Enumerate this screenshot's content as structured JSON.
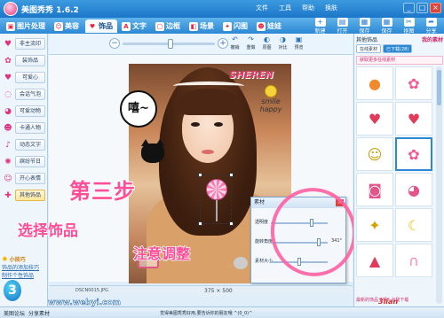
{
  "app": {
    "title": "美图秀秀 1.6.2"
  },
  "menu": [
    "文件",
    "工具",
    "帮助",
    "换肤"
  ],
  "window_buttons": [
    "_",
    "□",
    "×"
  ],
  "tabs": [
    {
      "label": "图片处理",
      "icon": "picture-icon"
    },
    {
      "label": "美容",
      "icon": "beauty-icon"
    },
    {
      "label": "饰品",
      "icon": "accessory-icon"
    },
    {
      "label": "文字",
      "icon": "text-icon"
    },
    {
      "label": "边框",
      "icon": "frame-icon"
    },
    {
      "label": "场景",
      "icon": "scene-icon"
    },
    {
      "label": "闪图",
      "icon": "flash-icon"
    },
    {
      "label": "娃娃",
      "icon": "doll-icon"
    }
  ],
  "active_tab": "饰品",
  "top_right": [
    {
      "label": "新建",
      "icon": "new-icon"
    },
    {
      "label": "打开",
      "icon": "open-icon"
    },
    {
      "label": "保存",
      "icon": "save-icon"
    },
    {
      "label": "保存",
      "icon": "save-icon"
    },
    {
      "label": "抠图",
      "icon": "cutout-icon"
    },
    {
      "label": "分享",
      "icon": "share-icon"
    }
  ],
  "left_panel": {
    "items": [
      {
        "label": "非主流印",
        "icon": "heart-icon"
      },
      {
        "label": "装饰品",
        "icon": "bow-icon"
      },
      {
        "label": "可爱心",
        "icon": "heart-icon"
      },
      {
        "label": "会话气泡",
        "icon": "bubble-icon"
      },
      {
        "label": "可爱动物",
        "icon": "animal-icon"
      },
      {
        "label": "卡通人物",
        "icon": "cartoon-icon"
      },
      {
        "label": "动态文字",
        "icon": "text-anim-icon"
      },
      {
        "label": "缤纷节日",
        "icon": "festival-icon"
      },
      {
        "label": "开心表情",
        "icon": "smile-icon"
      },
      {
        "label": "其他饰品",
        "icon": "gift-icon"
      }
    ],
    "selected_index": 9,
    "tips_title": "小技巧",
    "tips": [
      "饰品的添加技巧",
      "制作个性饰品"
    ]
  },
  "editor": {
    "zoom_level": 0.52,
    "tools": [
      {
        "label": "撤销",
        "icon": "undo-icon"
      },
      {
        "label": "重做",
        "icon": "redo-icon"
      },
      {
        "label": "原图",
        "icon": "original-icon"
      },
      {
        "label": "对比",
        "icon": "compare-icon"
      },
      {
        "label": "预览",
        "icon": "preview-icon"
      }
    ]
  },
  "canvas": {
    "speech_text": "嘻~",
    "sheren_text": "SHEREN",
    "smile_text": "smile happy"
  },
  "dialog": {
    "title": "素材",
    "sliders": [
      {
        "label": "透明度",
        "value": "",
        "level": 0.72
      },
      {
        "label": "旋转角度",
        "value": "341°",
        "level": 0.85
      },
      {
        "label": "素材大小",
        "value": "",
        "level": 0.5
      }
    ]
  },
  "annotation": {
    "title": "第三步",
    "line1": "选择饰品",
    "line2": "注意调整"
  },
  "info": {
    "filename": "DSCN0015.JPG",
    "size": "375 × 500"
  },
  "right_panel": {
    "header": "其他饰品",
    "mine": "我的素材",
    "tabs": [
      "在线素材",
      "已下载(28)"
    ],
    "tab_active": 1,
    "online_link": "获取更多在线素材",
    "stickers": [
      {
        "name": "orange-sticker",
        "glyph": "●",
        "color": "#f08a2c"
      },
      {
        "name": "lollipop-sticker",
        "glyph": "✿",
        "color": "#ee5c98"
      },
      {
        "name": "strawberry-sticker",
        "glyph": "♥",
        "color": "#e23a5a"
      },
      {
        "name": "strawberry-sticker-2",
        "glyph": "♥",
        "color": "#e23a5a"
      },
      {
        "name": "smile-happy-sticker",
        "glyph": "☺",
        "color": "#c89b00"
      },
      {
        "name": "lollipop-sticker-2",
        "glyph": "✿",
        "color": "#ee5c98"
      },
      {
        "name": "camera-sticker",
        "glyph": "◙",
        "color": "#e3548a"
      },
      {
        "name": "cat-sticker",
        "glyph": "◕",
        "color": "#e3548a"
      },
      {
        "name": "bee-sticker",
        "glyph": "✦",
        "color": "#d4a300"
      },
      {
        "name": "banana-sticker",
        "glyph": "☾",
        "color": "#e6c200"
      },
      {
        "name": "strawberry-cake-sticker",
        "glyph": "▲",
        "color": "#e23a5a"
      },
      {
        "name": "bunny-sticker",
        "glyph": "∩",
        "color": "#f28bb3"
      }
    ],
    "selected_index": 5,
    "footer": "最新的饰品了吗? 点我下载"
  },
  "status": {
    "left_items": [
      "美图论坛",
      "分享素材"
    ],
    "tip": "觉得美图秀秀好用,要告诉你的朋友哦 ^(0_0)^"
  },
  "watermarks": [
    "www.webyi.com",
    "3lian"
  ]
}
